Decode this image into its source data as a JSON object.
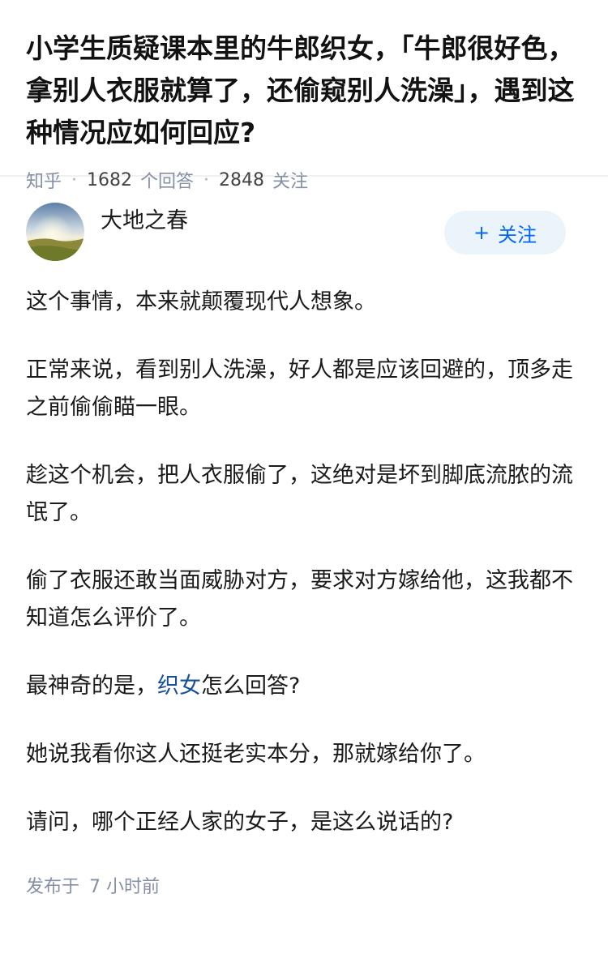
{
  "question": {
    "title": "小学生质疑课本里的牛郎织女，「牛郎很好色，拿别人衣服就算了，还偷窥别人洗澡」，遇到这种情况应如何回应?",
    "source": "知乎",
    "answer_count": "1682",
    "answer_unit": "个回答",
    "follower_count": "2848",
    "follower_unit": "关注"
  },
  "author": {
    "name": "大地之春",
    "follow_label": "关注",
    "follow_icon": "plus-icon"
  },
  "answer": {
    "p1": "这个事情，本来就颠覆现代人想象。",
    "p2": "正常来说，看到别人洗澡，好人都是应该回避的，顶多走之前偷偷瞄一眼。",
    "p3": "趁这个机会，把人衣服偷了，这绝对是坏到脚底流脓的流氓了。",
    "p4": "偷了衣服还敢当面威胁对方，要求对方嫁给他，这我都不知道怎么评价了。",
    "p5_prefix": "最神奇的是，",
    "p5_link": "织女",
    "p5_suffix": "怎么回答?",
    "p6": "她说我看你这人还挺老实本分，那就嫁给你了。",
    "p7": "请问，哪个正经人家的女子，是这么说话的?"
  },
  "published": {
    "label": "发布于",
    "time": "7 小时前"
  },
  "colors": {
    "accent": "#0066ff",
    "link": "#175199",
    "meta": "#8590a6",
    "follow_bg": "#ebf3fb"
  }
}
